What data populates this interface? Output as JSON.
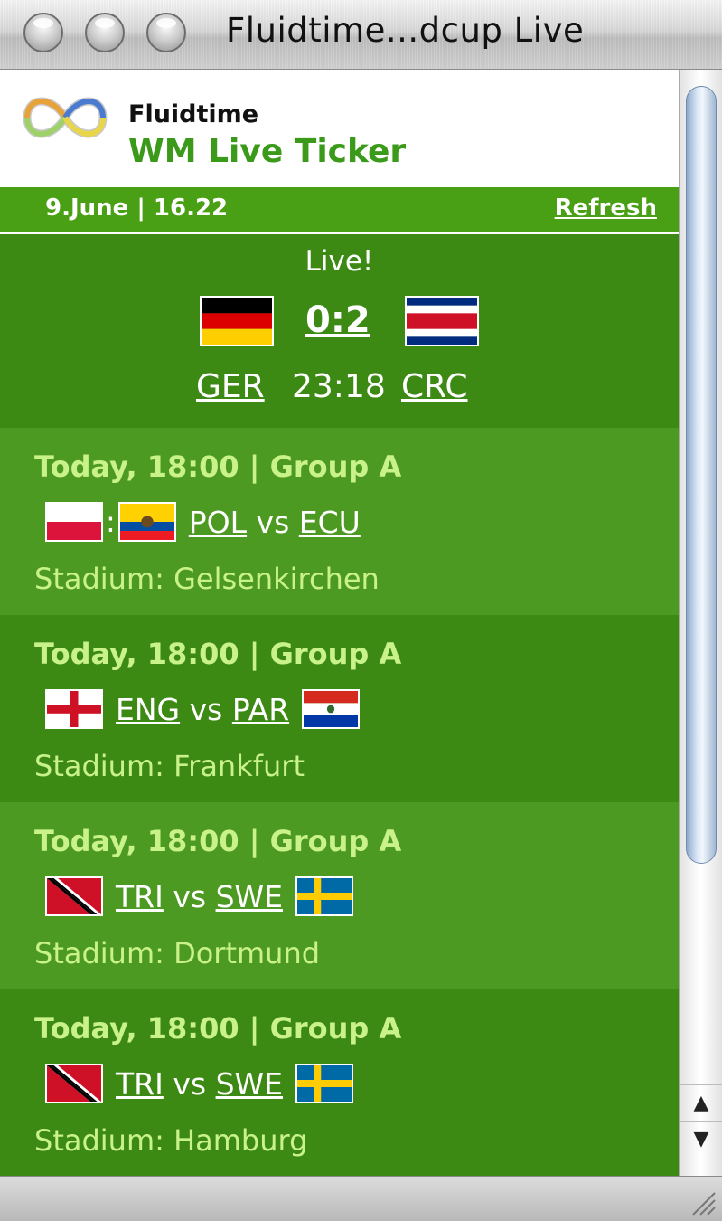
{
  "window": {
    "title": "Fluidtime...dcup Live"
  },
  "header": {
    "brand": "Fluidtime",
    "tagline": "WM Live Ticker"
  },
  "datebar": {
    "datetime": "9.June | 16.22",
    "refresh_label": "Refresh"
  },
  "live": {
    "label": "Live!",
    "score": "0:2",
    "home_code": "GER",
    "away_code": "CRC",
    "time": "23:18"
  },
  "matches": [
    {
      "title": "Today, 18:00 | Group A",
      "team1": "POL",
      "vs": "vs",
      "team2": "ECU",
      "stadium": "Stadium: Gelsenkirchen"
    },
    {
      "title": "Today, 18:00 | Group A",
      "team1": "ENG",
      "vs": "vs",
      "team2": "PAR",
      "stadium": "Stadium: Frankfurt"
    },
    {
      "title": "Today, 18:00 | Group A",
      "team1": "TRI",
      "vs": "vs",
      "team2": "SWE",
      "stadium": "Stadium: Dortmund"
    },
    {
      "title": "Today, 18:00 | Group A",
      "team1": "TRI",
      "vs": "vs",
      "team2": "SWE",
      "stadium": "Stadium: Hamburg"
    }
  ],
  "scrollbar": {
    "up_arrow": "▲",
    "down_arrow": "▼"
  },
  "colors": {
    "green_dark": "#3c8a14",
    "green_light": "#4d9a22",
    "accent_green": "#4aa015",
    "text_lime": "#c9f28a"
  }
}
